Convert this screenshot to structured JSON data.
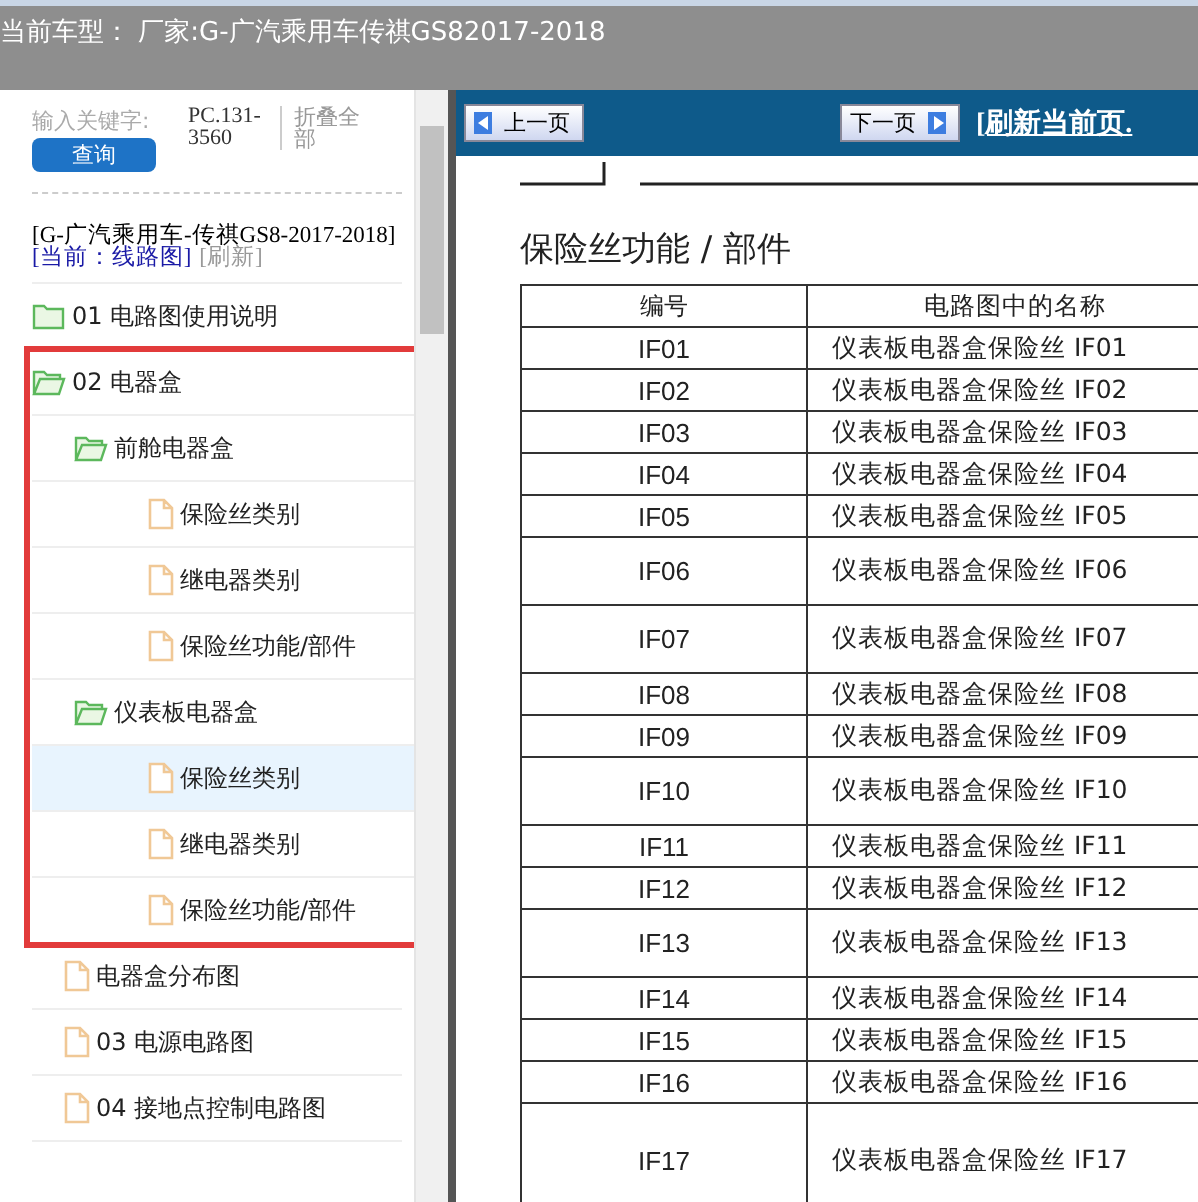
{
  "header": {
    "title": "当前车型： 厂家:G-广汽乘用车传祺GS82017-2018"
  },
  "sidebar": {
    "search": {
      "placeholder": "输入关键字:",
      "button": "查询",
      "code": "PC.131-3560",
      "collapse_all": "折叠全部"
    },
    "vehicle": "[G-广汽乘用车-传祺GS8-2017-2018]",
    "current": "[当前：线路图]",
    "refresh": "[刷新]",
    "tree": [
      {
        "label": "01 电路图使用说明",
        "kind": "folder",
        "expanded": false,
        "selected": false
      },
      {
        "label": "02 电器盒",
        "kind": "folder",
        "expanded": true,
        "highlighted": true,
        "selected": false,
        "children": [
          {
            "label": "前舱电器盒",
            "kind": "folder",
            "expanded": true,
            "selected": false,
            "children": [
              {
                "label": "保险丝类别",
                "kind": "page",
                "selected": false
              },
              {
                "label": "继电器类别",
                "kind": "page",
                "selected": false
              },
              {
                "label": "保险丝功能/部件",
                "kind": "page",
                "selected": false
              }
            ]
          },
          {
            "label": "仪表板电器盒",
            "kind": "folder",
            "expanded": true,
            "selected": false,
            "children": [
              {
                "label": "保险丝类别",
                "kind": "page",
                "selected": true
              },
              {
                "label": "继电器类别",
                "kind": "page",
                "selected": false
              },
              {
                "label": "保险丝功能/部件",
                "kind": "page",
                "selected": false
              }
            ]
          }
        ]
      },
      {
        "label": "电器盒分布图",
        "kind": "page",
        "selected": false
      },
      {
        "label": "03 电源电路图",
        "kind": "page",
        "selected": false
      },
      {
        "label": "04 接地点控制电路图",
        "kind": "page",
        "selected": false
      }
    ]
  },
  "toolbar": {
    "prev": "上一页",
    "next": "下一页",
    "refresh": "[刷新当前页."
  },
  "document": {
    "title": "保险丝功能 / 部件",
    "columns": [
      "编号",
      "电路图中的名称"
    ],
    "rows": [
      {
        "id": "IF01",
        "name": "仪表板电器盒保险丝 IF01",
        "kind": "normal"
      },
      {
        "id": "IF02",
        "name": "仪表板电器盒保险丝 IF02",
        "kind": "normal"
      },
      {
        "id": "IF03",
        "name": "仪表板电器盒保险丝 IF03",
        "kind": "normal"
      },
      {
        "id": "IF04",
        "name": "仪表板电器盒保险丝 IF04",
        "kind": "normal"
      },
      {
        "id": "IF05",
        "name": "仪表板电器盒保险丝 IF05",
        "kind": "normal"
      },
      {
        "id": "IF06",
        "name": "仪表板电器盒保险丝 IF06",
        "kind": "tall"
      },
      {
        "id": "IF07",
        "name": "仪表板电器盒保险丝 IF07",
        "kind": "tall"
      },
      {
        "id": "IF08",
        "name": "仪表板电器盒保险丝 IF08",
        "kind": "normal"
      },
      {
        "id": "IF09",
        "name": "仪表板电器盒保险丝 IF09",
        "kind": "normal"
      },
      {
        "id": "IF10",
        "name": "仪表板电器盒保险丝 IF10",
        "kind": "tall"
      },
      {
        "id": "IF11",
        "name": "仪表板电器盒保险丝 IF11",
        "kind": "normal"
      },
      {
        "id": "IF12",
        "name": "仪表板电器盒保险丝 IF12",
        "kind": "normal"
      },
      {
        "id": "IF13",
        "name": "仪表板电器盒保险丝 IF13",
        "kind": "tall"
      },
      {
        "id": "IF14",
        "name": "仪表板电器盒保险丝 IF14",
        "kind": "normal"
      },
      {
        "id": "IF15",
        "name": "仪表板电器盒保险丝 IF15",
        "kind": "normal"
      },
      {
        "id": "IF16",
        "name": "仪表板电器盒保险丝 IF16",
        "kind": "normal"
      },
      {
        "id": "IF17",
        "name": "仪表板电器盒保险丝 IF17",
        "kind": "xtall"
      }
    ]
  }
}
